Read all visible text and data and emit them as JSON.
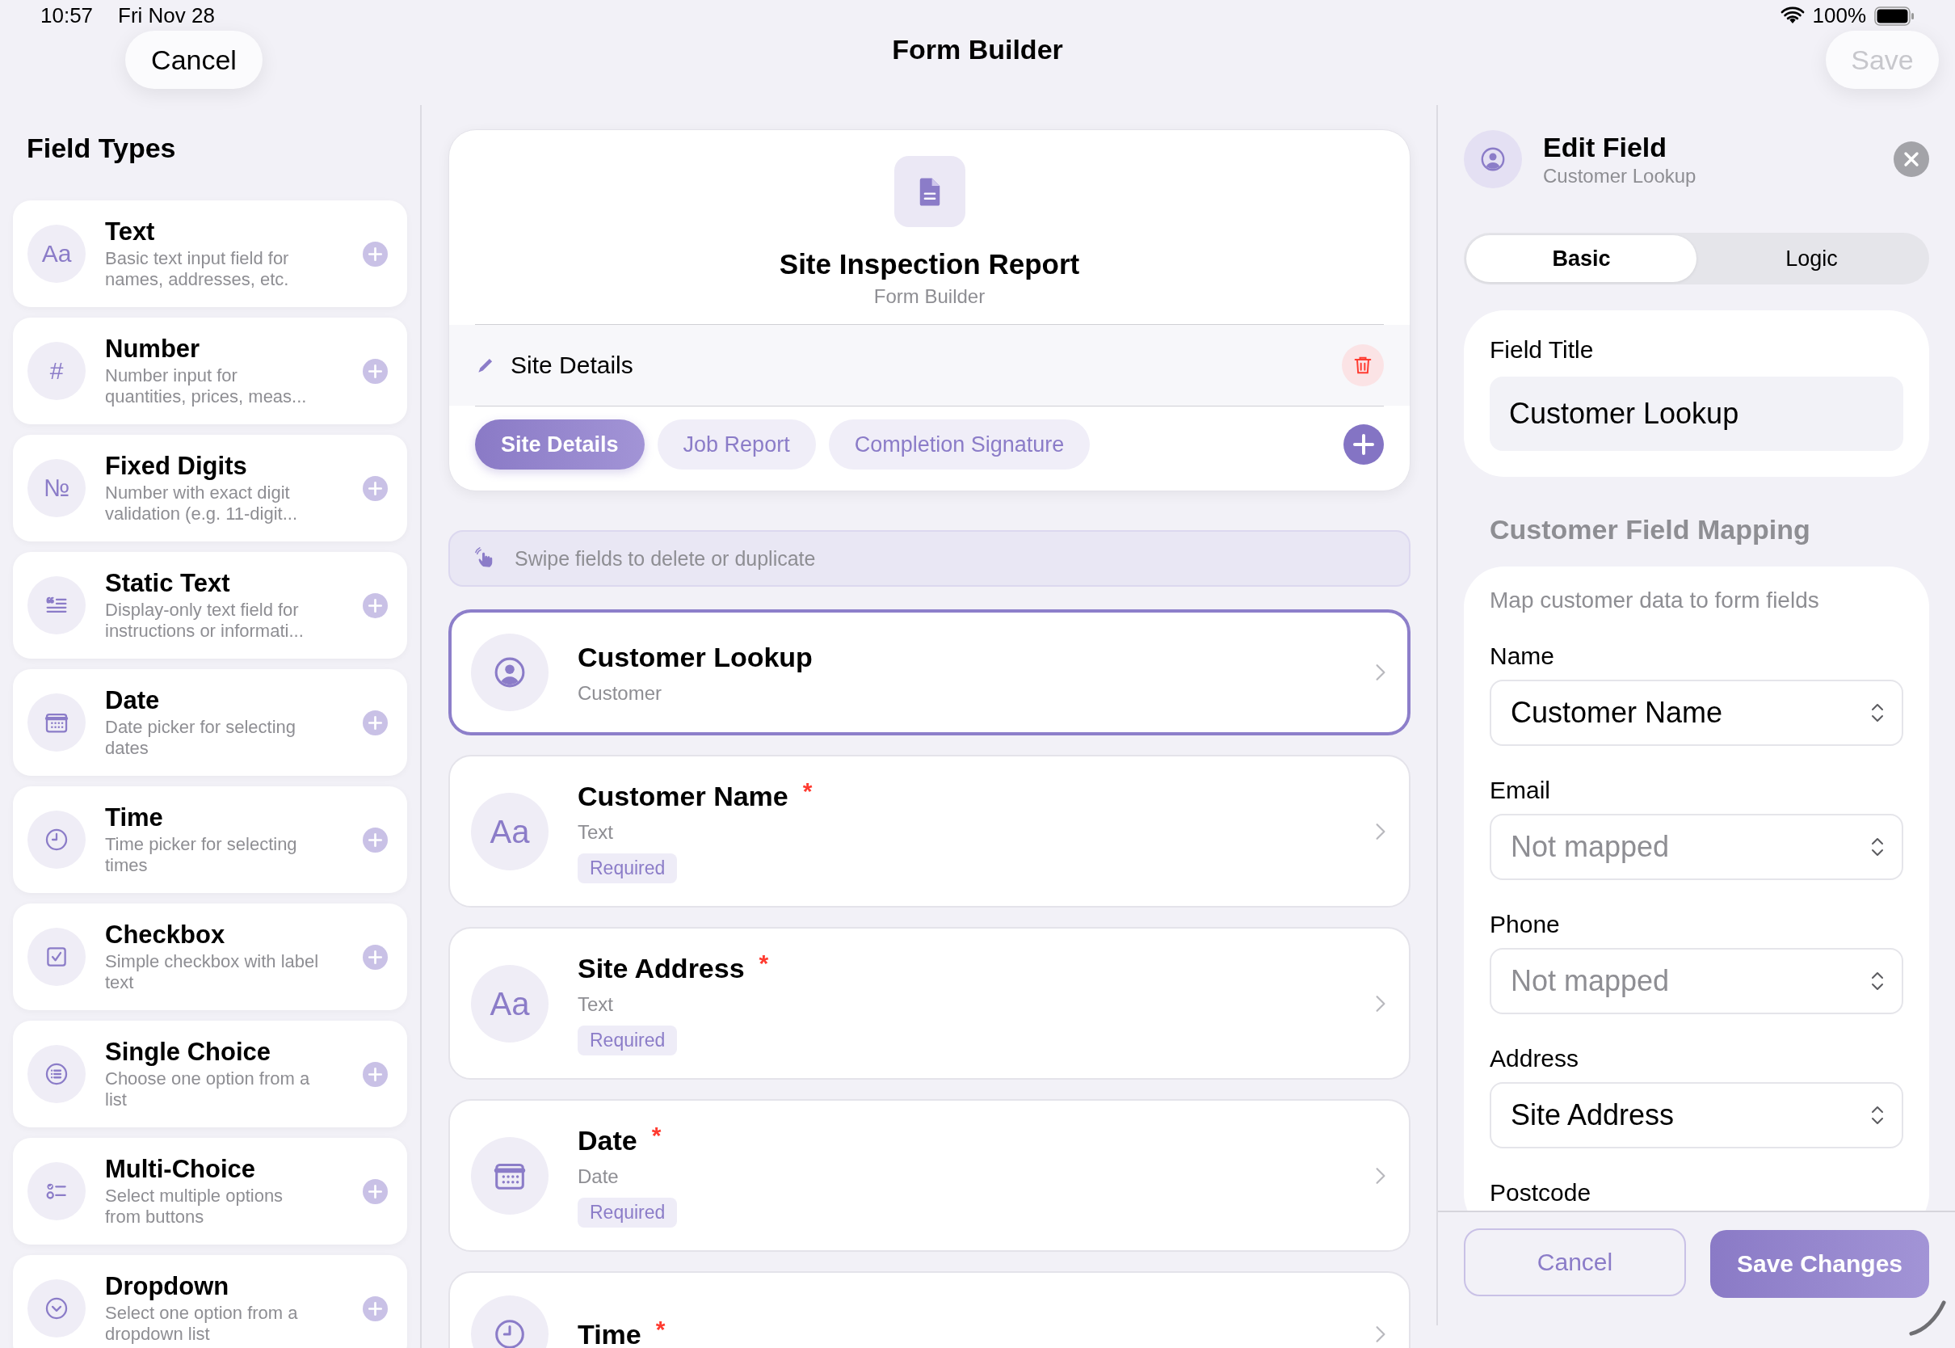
{
  "status_bar": {
    "time": "10:57",
    "date": "Fri Nov 28",
    "battery": "100%"
  },
  "nav": {
    "title": "Form Builder",
    "cancel": "Cancel",
    "save": "Save",
    "save_disabled": true
  },
  "field_types": {
    "title": "Field Types",
    "items": [
      {
        "kind": "glyph",
        "glyph": "Aa",
        "name": "Text",
        "description": "Basic text input field for names, addresses, etc."
      },
      {
        "kind": "glyph",
        "glyph": "#",
        "name": "Number",
        "description": "Number input for quantities, prices, meas..."
      },
      {
        "kind": "glyph",
        "glyph": "№",
        "name": "Fixed Digits",
        "description": "Number with exact digit validation (e.g. 11-digit..."
      },
      {
        "kind": "quote",
        "name": "Static Text",
        "description": "Display-only text field for instructions or informati..."
      },
      {
        "kind": "calendar",
        "name": "Date",
        "description": "Date picker for selecting dates"
      },
      {
        "kind": "clock",
        "name": "Time",
        "description": "Time picker for selecting times"
      },
      {
        "kind": "checkbox",
        "name": "Checkbox",
        "description": "Simple checkbox with label text"
      },
      {
        "kind": "list",
        "name": "Single Choice",
        "description": "Choose one option from a list"
      },
      {
        "kind": "multi",
        "name": "Multi-Choice",
        "description": "Select multiple options from buttons"
      },
      {
        "kind": "dropdown",
        "name": "Dropdown",
        "description": "Select one option from a dropdown list"
      }
    ]
  },
  "form": {
    "title": "Site Inspection Report",
    "subtitle": "Form Builder",
    "section_name": "Site Details",
    "sections": [
      {
        "label": "Site Details",
        "selected": true
      },
      {
        "label": "Job Report",
        "selected": false
      },
      {
        "label": "Completion Signature",
        "selected": false
      }
    ],
    "hint": "Swipe fields to delete or duplicate",
    "fields": [
      {
        "kind": "person",
        "title": "Customer Lookup",
        "type": "Customer",
        "selected": true
      },
      {
        "kind": "glyph",
        "glyph": "Aa",
        "title": "Customer Name",
        "asterisk": "*",
        "type": "Text",
        "badge": "Required",
        "selected": false
      },
      {
        "kind": "glyph",
        "glyph": "Aa",
        "title": "Site Address",
        "asterisk": "*",
        "type": "Text",
        "badge": "Required",
        "selected": false
      },
      {
        "kind": "calendar",
        "title": "Date",
        "asterisk": "*",
        "type": "Date",
        "badge": "Required",
        "selected": false
      },
      {
        "kind": "clock",
        "title": "Time",
        "asterisk": "*",
        "selected": false
      }
    ]
  },
  "editor": {
    "title": "Edit Field",
    "subtitle": "Customer Lookup",
    "tabs": [
      {
        "label": "Basic",
        "selected": true
      },
      {
        "label": "Logic",
        "selected": false
      }
    ],
    "field_title_label": "Field Title",
    "field_title_value": "Customer Lookup",
    "mapping_heading": "Customer Field Mapping",
    "mapping_hint": "Map customer data to form fields",
    "mappings": [
      {
        "label": "Name",
        "value": "Customer Name",
        "mapped": true
      },
      {
        "label": "Email",
        "value": "Not mapped",
        "mapped": false
      },
      {
        "label": "Phone",
        "value": "Not mapped",
        "mapped": false
      },
      {
        "label": "Address",
        "value": "Site Address",
        "mapped": true
      },
      {
        "label": "Postcode"
      }
    ],
    "cancel": "Cancel",
    "save": "Save Changes"
  }
}
